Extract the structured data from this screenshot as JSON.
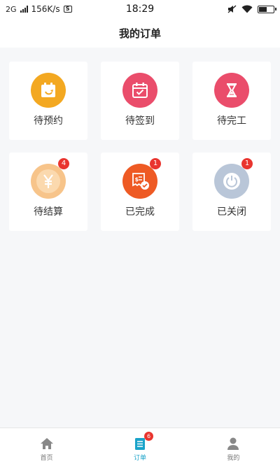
{
  "status_bar": {
    "network": "2G",
    "speed": "156K/s",
    "notice_glyph": "S",
    "time": "18:29",
    "battery_level_fraction": 0.5
  },
  "header": {
    "title": "我的订单"
  },
  "orders": [
    {
      "label": "待预约",
      "icon": "calendar-arrow-icon",
      "color": "#f3a821",
      "badge": ""
    },
    {
      "label": "待签到",
      "icon": "calendar-check-icon",
      "color": "#ea4d6b",
      "badge": ""
    },
    {
      "label": "待完工",
      "icon": "hourglass-icon",
      "color": "#ea4d6b",
      "badge": ""
    },
    {
      "label": "待结算",
      "icon": "yen-icon",
      "color": "#f7c48a",
      "badge": "4"
    },
    {
      "label": "已完成",
      "icon": "receipt-check-icon",
      "color": "#ee5a24",
      "badge": "1"
    },
    {
      "label": "已关闭",
      "icon": "power-icon",
      "color": "#b9c6d8",
      "badge": "1"
    }
  ],
  "tabbar": {
    "tabs": [
      {
        "label": "首页",
        "icon": "home-icon",
        "active": false
      },
      {
        "label": "订单",
        "icon": "order-list-icon",
        "active": true,
        "badge": "6"
      },
      {
        "label": "我的",
        "icon": "profile-icon",
        "active": false
      }
    ],
    "active_color": "#1aa3c9"
  }
}
